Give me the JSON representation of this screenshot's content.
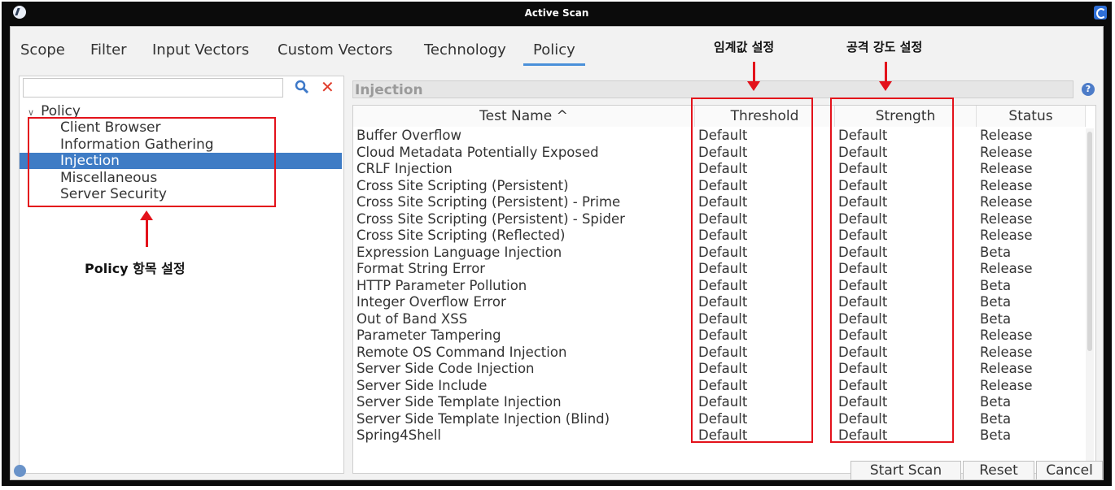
{
  "window": {
    "title": "Active Scan"
  },
  "tabs": [
    "Scope",
    "Filter",
    "Input Vectors",
    "Custom Vectors",
    "Technology",
    "Policy"
  ],
  "active_tab": "Policy",
  "left_panel": {
    "search": {
      "value": "",
      "placeholder": ""
    },
    "tree": {
      "root": "Policy",
      "items": [
        "Client Browser",
        "Information Gathering",
        "Injection",
        "Miscellaneous",
        "Server Security"
      ],
      "selected": "Injection"
    }
  },
  "right_panel": {
    "section_title": "Injection",
    "columns": [
      "Test Name ^",
      "Threshold",
      "Strength",
      "Status"
    ],
    "rows": [
      [
        "Buffer Overflow",
        "Default",
        "Default",
        "Release"
      ],
      [
        "Cloud Metadata Potentially Exposed",
        "Default",
        "Default",
        "Release"
      ],
      [
        "CRLF Injection",
        "Default",
        "Default",
        "Release"
      ],
      [
        "Cross Site Scripting (Persistent)",
        "Default",
        "Default",
        "Release"
      ],
      [
        "Cross Site Scripting (Persistent) - Prime",
        "Default",
        "Default",
        "Release"
      ],
      [
        "Cross Site Scripting (Persistent) - Spider",
        "Default",
        "Default",
        "Release"
      ],
      [
        "Cross Site Scripting (Reflected)",
        "Default",
        "Default",
        "Release"
      ],
      [
        "Expression Language Injection",
        "Default",
        "Default",
        "Beta"
      ],
      [
        "Format String Error",
        "Default",
        "Default",
        "Release"
      ],
      [
        "HTTP Parameter Pollution",
        "Default",
        "Default",
        "Beta"
      ],
      [
        "Integer Overflow Error",
        "Default",
        "Default",
        "Beta"
      ],
      [
        "Out of Band XSS",
        "Default",
        "Default",
        "Beta"
      ],
      [
        "Parameter Tampering",
        "Default",
        "Default",
        "Release"
      ],
      [
        "Remote OS Command Injection",
        "Default",
        "Default",
        "Release"
      ],
      [
        "Server Side Code Injection",
        "Default",
        "Default",
        "Release"
      ],
      [
        "Server Side Include",
        "Default",
        "Default",
        "Release"
      ],
      [
        "Server Side Template Injection",
        "Default",
        "Default",
        "Beta"
      ],
      [
        "Server Side Template Injection (Blind)",
        "Default",
        "Default",
        "Beta"
      ],
      [
        "Spring4Shell",
        "Default",
        "Default",
        "Beta"
      ]
    ]
  },
  "footer": {
    "buttons": [
      "Start Scan",
      "Reset",
      "Cancel"
    ]
  },
  "annotations": {
    "threshold": "임계값 설정",
    "strength": "공격 강도 설정",
    "policy": "Policy 항목 설정"
  },
  "colors": {
    "annotation": "#e3121b",
    "selection": "#3f7cc5",
    "title_bar": "#0b0b0b"
  }
}
